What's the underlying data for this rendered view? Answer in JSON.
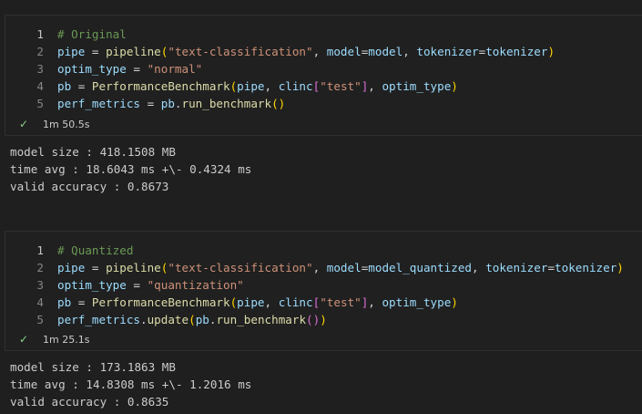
{
  "cells": [
    {
      "lines": [
        {
          "num": "1",
          "tokens": [
            {
              "t": "# Original",
              "c": "comment"
            }
          ]
        },
        {
          "num": "2",
          "tokens": [
            {
              "t": "pipe",
              "c": "var"
            },
            {
              "t": " = ",
              "c": "op"
            },
            {
              "t": "pipeline",
              "c": "fn"
            },
            {
              "t": "(",
              "c": "br1"
            },
            {
              "t": "\"text-classification\"",
              "c": "str"
            },
            {
              "t": ", ",
              "c": "op"
            },
            {
              "t": "model",
              "c": "var"
            },
            {
              "t": "=",
              "c": "op"
            },
            {
              "t": "model",
              "c": "var"
            },
            {
              "t": ", ",
              "c": "op"
            },
            {
              "t": "tokenizer",
              "c": "var"
            },
            {
              "t": "=",
              "c": "op"
            },
            {
              "t": "tokenizer",
              "c": "var"
            },
            {
              "t": ")",
              "c": "br1"
            }
          ]
        },
        {
          "num": "3",
          "tokens": [
            {
              "t": "optim_type",
              "c": "var"
            },
            {
              "t": " = ",
              "c": "op"
            },
            {
              "t": "\"normal\"",
              "c": "str"
            }
          ]
        },
        {
          "num": "4",
          "tokens": [
            {
              "t": "pb",
              "c": "var"
            },
            {
              "t": " = ",
              "c": "op"
            },
            {
              "t": "PerformanceBenchmark",
              "c": "fn"
            },
            {
              "t": "(",
              "c": "br1"
            },
            {
              "t": "pipe",
              "c": "var"
            },
            {
              "t": ", ",
              "c": "op"
            },
            {
              "t": "clinc",
              "c": "var"
            },
            {
              "t": "[",
              "c": "br2"
            },
            {
              "t": "\"test\"",
              "c": "str"
            },
            {
              "t": "]",
              "c": "br2"
            },
            {
              "t": ", ",
              "c": "op"
            },
            {
              "t": "optim_type",
              "c": "var"
            },
            {
              "t": ")",
              "c": "br1"
            }
          ]
        },
        {
          "num": "5",
          "tokens": [
            {
              "t": "perf_metrics",
              "c": "var"
            },
            {
              "t": " = ",
              "c": "op"
            },
            {
              "t": "pb",
              "c": "var"
            },
            {
              "t": ".",
              "c": "op"
            },
            {
              "t": "run_benchmark",
              "c": "fn"
            },
            {
              "t": "()",
              "c": "br1"
            }
          ]
        }
      ],
      "status": {
        "check_icon": "check-icon",
        "duration": "1m 50.5s"
      },
      "output": [
        "model size : 418.1508 MB",
        "time avg : 18.6043 ms +\\- 0.4324 ms",
        "valid accuracy : 0.8673"
      ]
    },
    {
      "lines": [
        {
          "num": "1",
          "tokens": [
            {
              "t": "# Quantized",
              "c": "comment"
            }
          ]
        },
        {
          "num": "2",
          "tokens": [
            {
              "t": "pipe",
              "c": "var"
            },
            {
              "t": " = ",
              "c": "op"
            },
            {
              "t": "pipeline",
              "c": "fn"
            },
            {
              "t": "(",
              "c": "br1"
            },
            {
              "t": "\"text-classification\"",
              "c": "str"
            },
            {
              "t": ", ",
              "c": "op"
            },
            {
              "t": "model",
              "c": "var"
            },
            {
              "t": "=",
              "c": "op"
            },
            {
              "t": "model_quantized",
              "c": "var"
            },
            {
              "t": ", ",
              "c": "op"
            },
            {
              "t": "tokenizer",
              "c": "var"
            },
            {
              "t": "=",
              "c": "op"
            },
            {
              "t": "tokenizer",
              "c": "var"
            },
            {
              "t": ")",
              "c": "br1"
            }
          ]
        },
        {
          "num": "3",
          "tokens": [
            {
              "t": "optim_type",
              "c": "var"
            },
            {
              "t": " = ",
              "c": "op"
            },
            {
              "t": "\"quantization\"",
              "c": "str"
            }
          ]
        },
        {
          "num": "4",
          "tokens": [
            {
              "t": "pb",
              "c": "var"
            },
            {
              "t": " = ",
              "c": "op"
            },
            {
              "t": "PerformanceBenchmark",
              "c": "fn"
            },
            {
              "t": "(",
              "c": "br1"
            },
            {
              "t": "pipe",
              "c": "var"
            },
            {
              "t": ", ",
              "c": "op"
            },
            {
              "t": "clinc",
              "c": "var"
            },
            {
              "t": "[",
              "c": "br2"
            },
            {
              "t": "\"test\"",
              "c": "str"
            },
            {
              "t": "]",
              "c": "br2"
            },
            {
              "t": ", ",
              "c": "op"
            },
            {
              "t": "optim_type",
              "c": "var"
            },
            {
              "t": ")",
              "c": "br1"
            }
          ]
        },
        {
          "num": "5",
          "tokens": [
            {
              "t": "perf_metrics",
              "c": "var"
            },
            {
              "t": ".",
              "c": "op"
            },
            {
              "t": "update",
              "c": "fn"
            },
            {
              "t": "(",
              "c": "br1"
            },
            {
              "t": "pb",
              "c": "var"
            },
            {
              "t": ".",
              "c": "op"
            },
            {
              "t": "run_benchmark",
              "c": "fn"
            },
            {
              "t": "()",
              "c": "br2"
            },
            {
              "t": ")",
              "c": "br1"
            }
          ]
        }
      ],
      "status": {
        "check_icon": "check-icon",
        "duration": "1m 25.1s"
      },
      "output": [
        "model size : 173.1863 MB",
        "time avg : 14.8308 ms +\\- 1.2016 ms",
        "valid accuracy : 0.8635"
      ]
    }
  ],
  "colors": {
    "background": "#1f1f1f",
    "comment": "#6a9955",
    "string": "#ce9178",
    "variable": "#9cdcfe",
    "function": "#dcdcaa",
    "bracket_level1": "#ffd700",
    "bracket_level2": "#da70d6",
    "success": "#89d185"
  }
}
